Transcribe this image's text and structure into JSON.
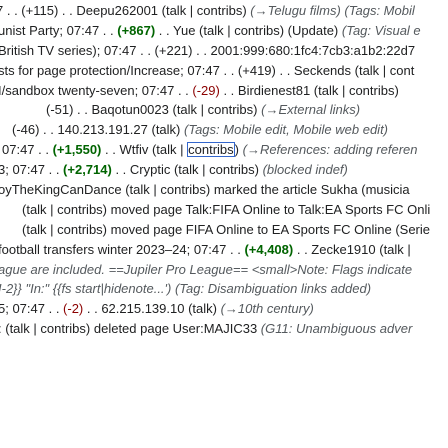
{
  "lines": [
    {
      "indent": -4,
      "segs": [
        {
          "t": "7 . . ",
          "k": "text"
        },
        {
          "t": "(+115)",
          "k": "text"
        },
        {
          "t": " . . Deepu262001 ",
          "k": "text"
        },
        {
          "t": "(talk | contribs)",
          "k": "link"
        },
        {
          "t": " (→Telugu films) (Tags: Mobil",
          "k": "italic"
        }
      ]
    },
    {
      "indent": -2,
      "segs": [
        {
          "t": "unist Party; 07:47 . . ",
          "k": "text"
        },
        {
          "t": "(+867)",
          "k": "plus"
        },
        {
          "t": " . . Yue ",
          "k": "text"
        },
        {
          "t": "(talk | contribs)",
          "k": "link"
        },
        {
          "t": " (Update) ",
          "k": "text"
        },
        {
          "t": "(Tag: Visual e",
          "k": "italic"
        }
      ]
    },
    {
      "indent": -2,
      "segs": [
        {
          "t": "British TV series); 07:47 . . (+221) . . 2001:999:680:1fc4:7cb3:a1b2:22d7",
          "k": "text"
        }
      ]
    },
    {
      "indent": -2,
      "segs": [
        {
          "t": "sts for page protection/Increase; 07:47 . . (+419) . . Seckends ",
          "k": "text"
        },
        {
          "t": "(talk | cont",
          "k": "link"
        }
      ]
    },
    {
      "indent": -2,
      "segs": [
        {
          "t": "I/sandbox twenty-seven; 07:47 . . ",
          "k": "text"
        },
        {
          "t": "(-29)",
          "k": "minus"
        },
        {
          "t": " . . Birdienest81 ",
          "k": "text"
        },
        {
          "t": "(talk | contribs)",
          "k": "link"
        }
      ]
    },
    {
      "indent": 46,
      "segs": [
        {
          "t": "(-51) . . Baqotun0023 ",
          "k": "text"
        },
        {
          "t": "(talk | contribs)",
          "k": "link"
        },
        {
          "t": " (→External links)",
          "k": "italic"
        }
      ]
    },
    {
      "indent": 12,
      "segs": [
        {
          "t": "(-46) . . 140.213.191.27 ",
          "k": "text"
        },
        {
          "t": "(talk)",
          "k": "link"
        },
        {
          "t": " ",
          "k": "text"
        },
        {
          "t": "(Tags: Mobile edit, Mobile web edit)",
          "k": "italic"
        }
      ]
    },
    {
      "indent": 2,
      "segs": [
        {
          "t": "07:47 . . ",
          "k": "text"
        },
        {
          "t": "(+1,550)",
          "k": "plus"
        },
        {
          "t": " . . Wtfiv ",
          "k": "text"
        },
        {
          "t": "(talk | ",
          "k": "link"
        },
        {
          "t": "contribs",
          "k": "boxed"
        },
        {
          "t": ")",
          "k": "link"
        },
        {
          "t": " (→References: adding referen",
          "k": "italic"
        }
      ]
    },
    {
      "indent": -2,
      "segs": [
        {
          "t": "3; 07:47 . . ",
          "k": "text"
        },
        {
          "t": "(+2,714)",
          "k": "plus"
        },
        {
          "t": " . . Cryptic ",
          "k": "text"
        },
        {
          "t": "(talk | contribs)",
          "k": "link"
        },
        {
          "t": " (blocked indef)",
          "k": "italic"
        }
      ]
    },
    {
      "indent": -2,
      "segs": [
        {
          "t": "oyTheKingCanDance ",
          "k": "text"
        },
        {
          "t": "(talk | contribs)",
          "k": "link"
        },
        {
          "t": " marked the article Sukha (musicia",
          "k": "text"
        }
      ]
    },
    {
      "indent": 22,
      "segs": [
        {
          "t": "(talk | contribs)",
          "k": "link"
        },
        {
          "t": " moved page Talk:FIFA Online to Talk:EA Sports FC Onli",
          "k": "text"
        }
      ]
    },
    {
      "indent": 22,
      "segs": [
        {
          "t": "(talk | contribs)",
          "k": "link"
        },
        {
          "t": " moved page FIFA Online to EA Sports FC Online (Serie",
          "k": "text"
        }
      ]
    },
    {
      "indent": -2,
      "segs": [
        {
          "t": "football transfers winter 2023–24; 07:47 . . ",
          "k": "text"
        },
        {
          "t": "(+4,408)",
          "k": "plus"
        },
        {
          "t": " . . Zecke1910 ",
          "k": "text"
        },
        {
          "t": "(talk |",
          "k": "link"
        }
      ]
    },
    {
      "indent": -2,
      "segs": [
        {
          "t": "ague are included. ==Jupiler Pro League== <small>Note: Flags indicate",
          "k": "italic"
        }
      ]
    },
    {
      "indent": -2,
      "segs": [
        {
          "t": "I-2}} \"In:\" {{fs start|hidenote...')",
          "k": "italic"
        },
        {
          "t": " (Tag: Disambiguation links added)",
          "k": "italic"
        }
      ]
    },
    {
      "indent": -2,
      "segs": [
        {
          "t": "5; 07:47 . . ",
          "k": "text"
        },
        {
          "t": "(-2)",
          "k": "minus"
        },
        {
          "t": " . . 62.215.139.10 ",
          "k": "text"
        },
        {
          "t": "(talk)",
          "k": "link"
        },
        {
          "t": " (→10th century)",
          "k": "italic"
        }
      ]
    },
    {
      "indent": -2,
      "segs": [
        {
          "t": ": ",
          "k": "text"
        },
        {
          "t": "(talk | contribs)",
          "k": "link"
        },
        {
          "t": " deleted page User:MAJIC33 ",
          "k": "text"
        },
        {
          "t": "(G11: Unambiguous adver",
          "k": "italic"
        }
      ]
    }
  ]
}
